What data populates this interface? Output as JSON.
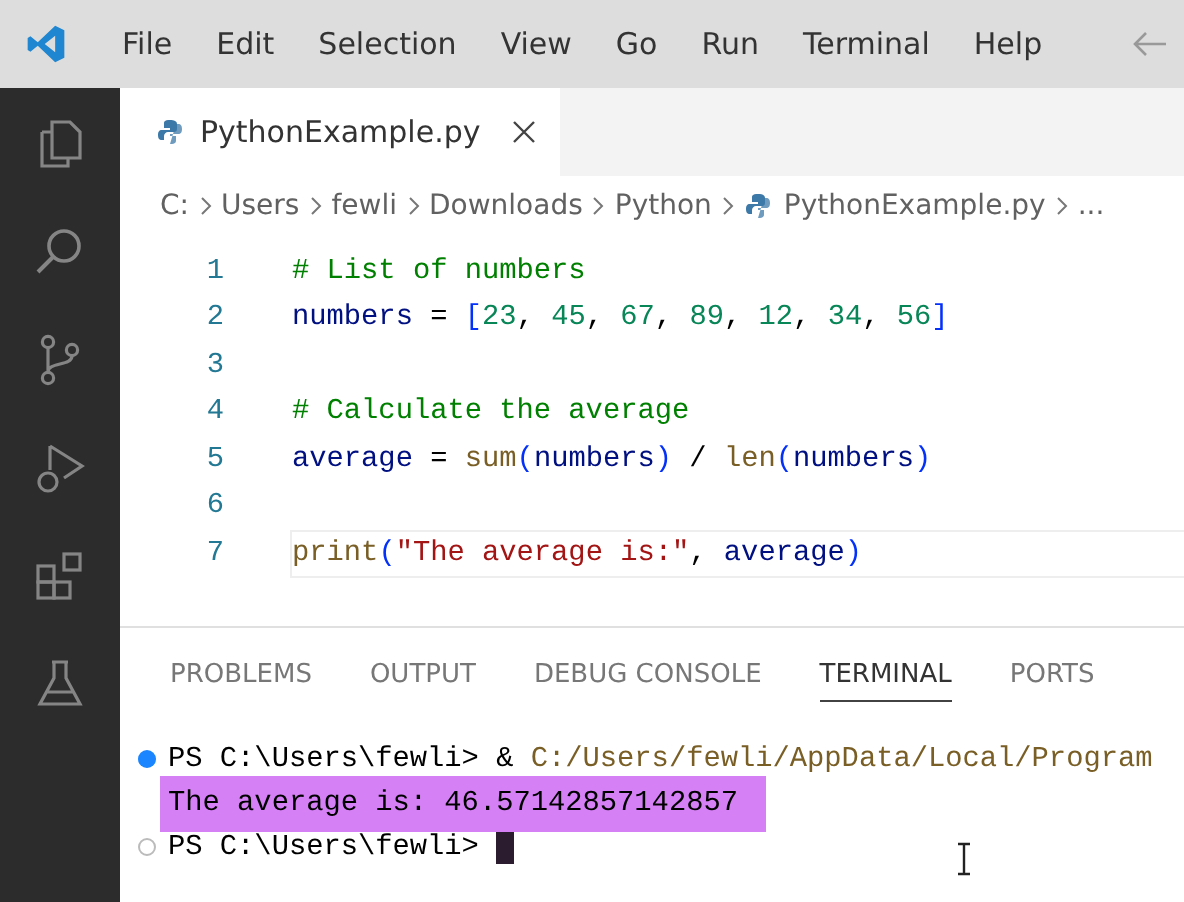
{
  "menu": [
    "File",
    "Edit",
    "Selection",
    "View",
    "Go",
    "Run",
    "Terminal",
    "Help"
  ],
  "editor_tabs": [
    {
      "label": "PythonExample.py",
      "selected": true
    }
  ],
  "breadcrumb": {
    "items": [
      {
        "label": "C:",
        "file": false
      },
      {
        "label": "Users",
        "file": false
      },
      {
        "label": "fewli",
        "file": false
      },
      {
        "label": "Downloads",
        "file": false
      },
      {
        "label": "Python",
        "file": false
      },
      {
        "label": "PythonExample.py",
        "file": true
      }
    ],
    "more": "..."
  },
  "code": [
    {
      "number": "1",
      "current": false,
      "tokens": [
        {
          "kind": "comment",
          "text": "# List of numbers"
        }
      ]
    },
    {
      "number": "2",
      "current": false,
      "tokens": [
        {
          "kind": "variable",
          "text": "numbers"
        },
        {
          "kind": "plain",
          "text": " = "
        },
        {
          "kind": "bracket",
          "text": "["
        },
        {
          "kind": "number",
          "text": "23"
        },
        {
          "kind": "plain",
          "text": ", "
        },
        {
          "kind": "number",
          "text": "45"
        },
        {
          "kind": "plain",
          "text": ", "
        },
        {
          "kind": "number",
          "text": "67"
        },
        {
          "kind": "plain",
          "text": ", "
        },
        {
          "kind": "number",
          "text": "89"
        },
        {
          "kind": "plain",
          "text": ", "
        },
        {
          "kind": "number",
          "text": "12"
        },
        {
          "kind": "plain",
          "text": ", "
        },
        {
          "kind": "number",
          "text": "34"
        },
        {
          "kind": "plain",
          "text": ", "
        },
        {
          "kind": "number",
          "text": "56"
        },
        {
          "kind": "bracket",
          "text": "]"
        }
      ]
    },
    {
      "number": "3",
      "current": false
    },
    {
      "number": "4",
      "current": false,
      "tokens": [
        {
          "kind": "comment",
          "text": "# Calculate the average"
        }
      ]
    },
    {
      "number": "5",
      "current": false,
      "tokens": [
        {
          "kind": "variable",
          "text": "average"
        },
        {
          "kind": "plain",
          "text": " = "
        },
        {
          "kind": "function",
          "text": "sum"
        },
        {
          "kind": "bracket",
          "text": "("
        },
        {
          "kind": "variable",
          "text": "numbers"
        },
        {
          "kind": "bracket",
          "text": ")"
        },
        {
          "kind": "plain",
          "text": " / "
        },
        {
          "kind": "function",
          "text": "len"
        },
        {
          "kind": "bracket",
          "text": "("
        },
        {
          "kind": "variable",
          "text": "numbers"
        },
        {
          "kind": "bracket",
          "text": ")"
        }
      ]
    },
    {
      "number": "6",
      "current": false
    },
    {
      "number": "7",
      "current": true,
      "tokens": [
        {
          "kind": "function",
          "text": "print"
        },
        {
          "kind": "bracket",
          "text": "("
        },
        {
          "kind": "string",
          "text": "\"The average is:\""
        },
        {
          "kind": "plain",
          "text": ", "
        },
        {
          "kind": "variable",
          "text": "average"
        },
        {
          "kind": "bracket",
          "text": ")"
        }
      ]
    }
  ],
  "panel_tabs": [
    {
      "label": "PROBLEMS",
      "selected": false
    },
    {
      "label": "OUTPUT",
      "selected": false
    },
    {
      "label": "DEBUG CONSOLE",
      "selected": false
    },
    {
      "label": "TERMINAL",
      "selected": true
    },
    {
      "label": "PORTS",
      "selected": false
    }
  ],
  "terminal": [
    {
      "kind": "command",
      "selected": false,
      "tokens": [
        {
          "kind": "plain",
          "text": "PS C:\\Users\\fewli> & "
        },
        {
          "kind": "path",
          "text": "C:/Users/fewli/AppData/Local/Program"
        }
      ]
    },
    {
      "kind": "output",
      "selected": true,
      "tokens": [
        {
          "kind": "plain",
          "text": "The average is: 46.57142857142857"
        }
      ]
    },
    {
      "kind": "prompt",
      "selected": false,
      "tokens": [
        {
          "kind": "plain",
          "text": "PS C:\\Users\\fewli> "
        }
      ]
    }
  ]
}
